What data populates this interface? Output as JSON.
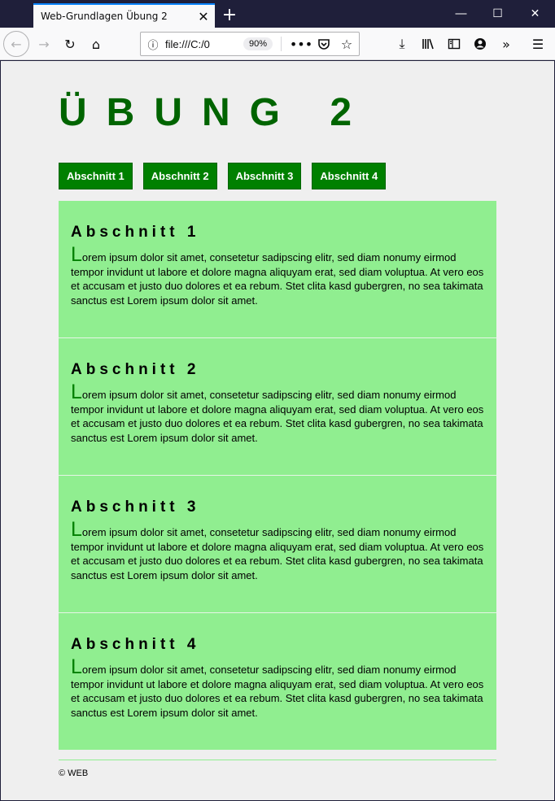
{
  "browser": {
    "tab_title": "Web-Grundlagen Übung 2",
    "url": "file:///C:/0",
    "zoom": "90%"
  },
  "page": {
    "title": "ÜBUNG 2",
    "nav": [
      "Abschnitt 1",
      "Abschnitt 2",
      "Abschnitt 3",
      "Abschnitt 4"
    ],
    "sections": [
      {
        "title": "Abschnitt 1",
        "dropcap": "L",
        "text": "orem ipsum dolor sit amet, consetetur sadipscing elitr, sed diam nonumy eirmod tempor invidunt ut labore et dolore magna aliquyam erat, sed diam voluptua. At vero eos et accusam et justo duo dolores et ea rebum. Stet clita kasd gubergren, no sea takimata sanctus est Lorem ipsum dolor sit amet."
      },
      {
        "title": "Abschnitt 2",
        "dropcap": "L",
        "text": "orem ipsum dolor sit amet, consetetur sadipscing elitr, sed diam nonumy eirmod tempor invidunt ut labore et dolore magna aliquyam erat, sed diam voluptua. At vero eos et accusam et justo duo dolores et ea rebum. Stet clita kasd gubergren, no sea takimata sanctus est Lorem ipsum dolor sit amet."
      },
      {
        "title": "Abschnitt 3",
        "dropcap": "L",
        "text": "orem ipsum dolor sit amet, consetetur sadipscing elitr, sed diam nonumy eirmod tempor invidunt ut labore et dolore magna aliquyam erat, sed diam voluptua. At vero eos et accusam et justo duo dolores et ea rebum. Stet clita kasd gubergren, no sea takimata sanctus est Lorem ipsum dolor sit amet."
      },
      {
        "title": "Abschnitt 4",
        "dropcap": "L",
        "text": "orem ipsum dolor sit amet, consetetur sadipscing elitr, sed diam nonumy eirmod tempor invidunt ut labore et dolore magna aliquyam erat, sed diam voluptua. At vero eos et accusam et justo duo dolores et ea rebum. Stet clita kasd gubergren, no sea takimata sanctus est Lorem ipsum dolor sit amet."
      }
    ],
    "footer": "© WEB"
  },
  "colors": {
    "title_green": "#006400",
    "nav_green": "#008000",
    "section_bg": "#90ee90",
    "page_bg": "#efefef"
  },
  "icons": {
    "tab_close": "close-icon",
    "new_tab": "plus-icon",
    "minimize": "minimize-icon",
    "maximize": "maximize-icon",
    "close_window": "close-icon",
    "back": "arrow-left-icon",
    "forward": "arrow-right-icon",
    "reload": "reload-icon",
    "home": "home-icon",
    "site_info": "info-icon",
    "page_actions": "more-icon",
    "pocket": "pocket-icon",
    "bookmark": "star-icon",
    "downloads": "download-icon",
    "library": "library-icon",
    "sidebar": "sidebar-icon",
    "account": "account-icon",
    "overflow": "chevron-double-right-icon",
    "menu": "hamburger-menu-icon"
  }
}
